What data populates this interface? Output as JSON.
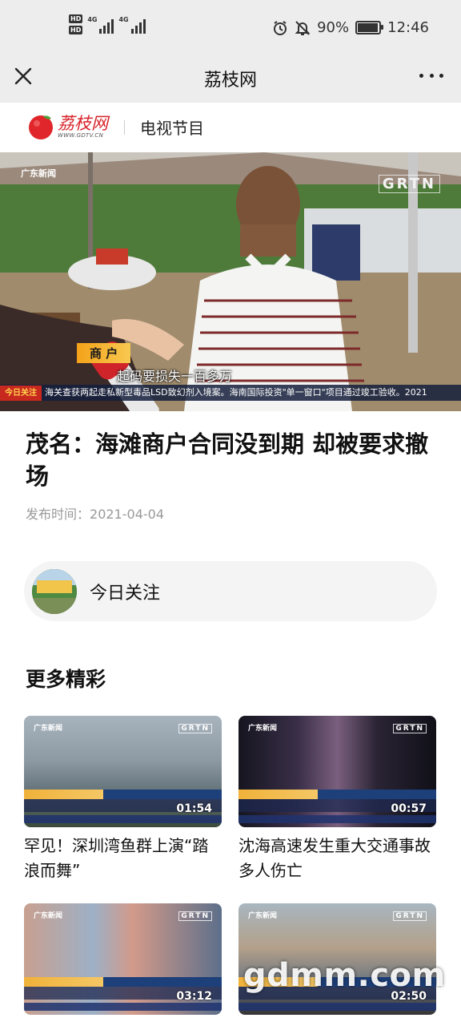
{
  "status_bar": {
    "left_badges": [
      "HD",
      "HD"
    ],
    "network": [
      "4G",
      "4G"
    ],
    "battery_text": "90%",
    "time": "12:46"
  },
  "nav": {
    "title": "荔枝网",
    "close_icon": "close-icon",
    "more_icon": "more-dots-icon"
  },
  "brand": {
    "logo_name": "荔枝网",
    "logo_url": "WWW.GDTV.CN",
    "section": "电视节目"
  },
  "hero": {
    "channel_watermark": "GRTN",
    "channel_logo": "广东新闻",
    "chyron_tag": "商 户",
    "subtitle": "起码要损失一百多万",
    "ticker_logo": "今日关注",
    "ticker": "海关查获两起走私新型毒品LSD致幻剂入境案。海南国际投资\"单一窗口\"项目通过竣工验收。2021"
  },
  "article": {
    "title": "茂名：海滩商户合同没到期 却被要求撤场",
    "date_label": "发布时间：",
    "date": "2021-04-04"
  },
  "follow": {
    "label": "今日关注"
  },
  "more": {
    "heading": "更多精彩",
    "items": [
      {
        "title": "罕见！深圳湾鱼群上演“踏浪而舞”",
        "duration": "01:54",
        "logo": "广东新闻",
        "watermark": "GRTN",
        "colors": [
          "#8a9ba8",
          "#5d6e7c",
          "#2f3d2a"
        ]
      },
      {
        "title": "沈海高速发生重大交通事故 多人伤亡",
        "duration": "00:57",
        "logo": "广东新闻",
        "watermark": "GRTN",
        "colors": [
          "#1a1a28",
          "#5a4a6a",
          "#3b2d2a"
        ]
      },
      {
        "title": "",
        "duration": "03:12",
        "logo": "广东新闻",
        "watermark": "GRTN",
        "colors": [
          "#9ab0c8",
          "#c49a86",
          "#4b5d78"
        ]
      },
      {
        "title": "",
        "duration": "02:50",
        "logo": "广东新闻",
        "watermark": "GRTN",
        "colors": [
          "#b8a68c",
          "#7c8a96",
          "#3a3a3a"
        ]
      }
    ]
  },
  "watermark": "gdmm.com"
}
